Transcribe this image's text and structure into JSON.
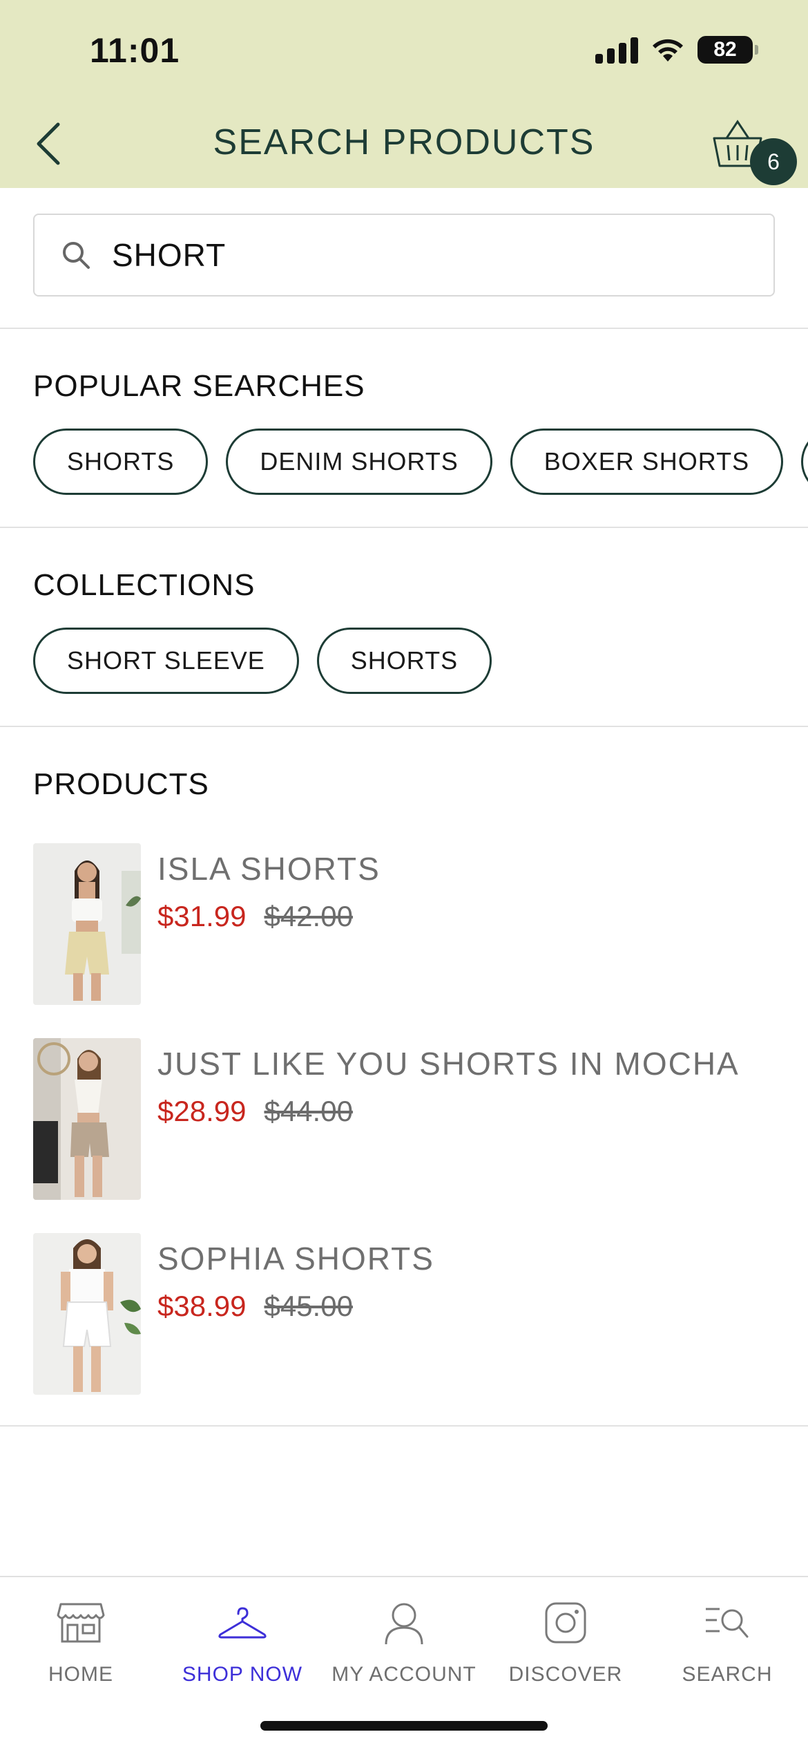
{
  "status_bar": {
    "time": "11:01",
    "battery": "82"
  },
  "header": {
    "title": "SEARCH PRODUCTS",
    "cart_count": "6"
  },
  "search": {
    "value": "SHORT",
    "placeholder": ""
  },
  "popular": {
    "title": "POPULAR SEARCHES",
    "chips": [
      "SHORTS",
      "DENIM SHORTS",
      "BOXER SHORTS"
    ]
  },
  "collections": {
    "title": "COLLECTIONS",
    "chips": [
      "SHORT SLEEVE",
      "SHORTS"
    ]
  },
  "products": {
    "title": "PRODUCTS",
    "items": [
      {
        "name": "ISLA SHORTS",
        "sale_price": "$31.99",
        "original_price": "$42.00"
      },
      {
        "name": "JUST LIKE YOU SHORTS IN MOCHA",
        "sale_price": "$28.99",
        "original_price": "$44.00"
      },
      {
        "name": "SOPHIA SHORTS",
        "sale_price": "$38.99",
        "original_price": "$45.00"
      }
    ]
  },
  "tabbar": {
    "items": [
      {
        "label": "HOME",
        "icon": "storefront-icon"
      },
      {
        "label": "SHOP NOW",
        "icon": "hanger-icon"
      },
      {
        "label": "MY ACCOUNT",
        "icon": "user-icon"
      },
      {
        "label": "DISCOVER",
        "icon": "instagram-icon"
      },
      {
        "label": "SEARCH",
        "icon": "search-list-icon"
      }
    ],
    "active_index": 1
  },
  "colors": {
    "header_bg": "#e4e8c2",
    "brand_dark_green": "#1d3c35",
    "sale_red": "#c8261e",
    "active_tab": "#3d2fd8"
  }
}
